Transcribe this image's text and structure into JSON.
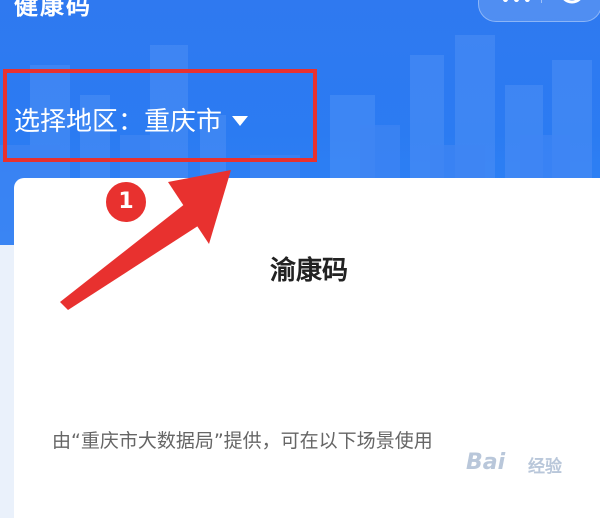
{
  "window": {
    "title": "健康码",
    "capsule_more": "•••"
  },
  "region": {
    "label": "选择地区：",
    "value": "重庆市"
  },
  "card": {
    "title": "渝康码",
    "description": "由“重庆市大数据局”提供，可在以下场景使用"
  },
  "annotation": {
    "step_number": "1",
    "color": "#e8312f"
  },
  "watermark": {
    "brand": "Bai",
    "label": "经验"
  },
  "colors": {
    "header": "#2b7bf2",
    "card_bg": "#ffffff",
    "page_bg": "#eaf1fb"
  },
  "icons": {
    "dropdown": "caret-down-icon",
    "close": "close-circle-icon",
    "arrow": "pointer-arrow-icon"
  }
}
